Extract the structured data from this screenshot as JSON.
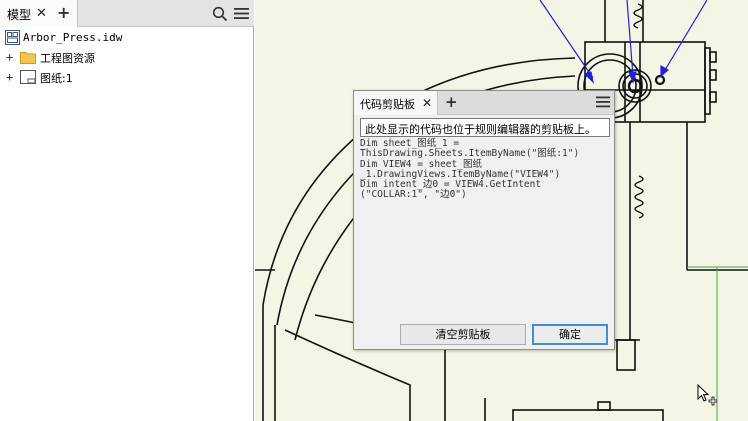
{
  "browser": {
    "tab_label": "模型",
    "close_glyph": "✕",
    "add_glyph": "+",
    "tree": [
      {
        "label": "Arbor_Press.idw",
        "icon": "drawing-file-icon",
        "expander": ""
      },
      {
        "label": "工程图资源",
        "icon": "folder-icon",
        "expander": "+"
      },
      {
        "label": "图纸:1",
        "icon": "sheet-icon",
        "expander": "+"
      }
    ]
  },
  "dialog": {
    "tab_label": "代码剪贴板",
    "close_glyph": "✕",
    "add_glyph": "+",
    "notice": "此处显示的代码也位于规则编辑器的剪贴板上。",
    "code_lines": [
      "Dim sheet_图纸_1 =",
      "ThisDrawing.Sheets.ItemByName(\"图纸:1\")",
      "Dim VIEW4 = sheet_图纸",
      "_1.DrawingViews.ItemByName(\"VIEW4\")",
      "Dim intent_边0 = VIEW4.GetIntent",
      "(\"COLLAR:1\", \"边0\")"
    ],
    "clear_button": "清空剪贴板",
    "ok_button": "确定"
  },
  "colors": {
    "canvas_bg": "#f5f5e6",
    "leader_blue": "#2020e0",
    "focus_blue": "#3c8fd8",
    "sketch_green": "#3aaa35"
  },
  "icons": [
    "search-icon",
    "menu-icon",
    "folder-icon",
    "sheet-icon",
    "drawing-file-icon",
    "mouse-cursor-icon"
  ]
}
